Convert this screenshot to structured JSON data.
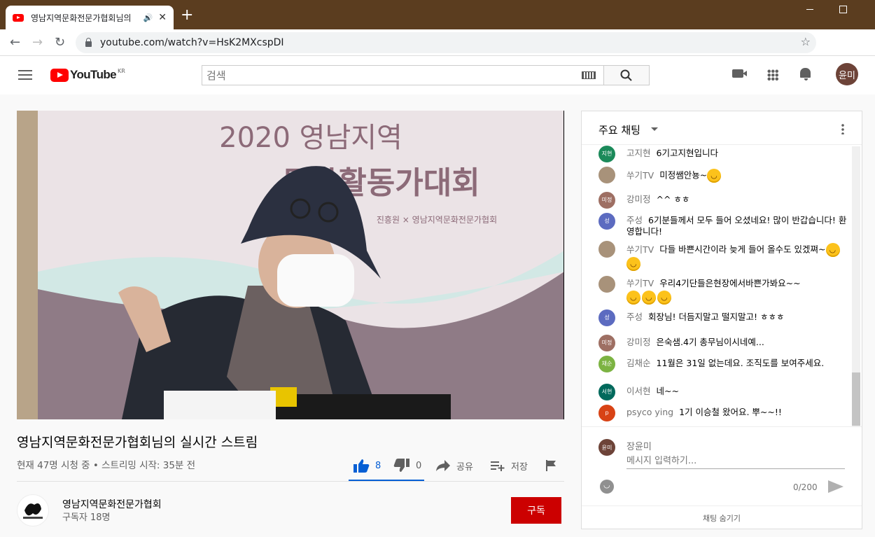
{
  "browser": {
    "tab_title": "영남지역문화전문가협회님의",
    "url": "youtube.com/watch?v=HsK2MXcspDI",
    "profile_initials": "윤미"
  },
  "header": {
    "logo_text": "YouTube",
    "region": "KR",
    "search_placeholder": "검색",
    "avatar_initials": "윤미"
  },
  "video": {
    "overlay_line1": "2020 영남지역",
    "overlay_line2": "문화활동가대회",
    "overlay_small": "진흥원 × 영남지역문화전문가협회",
    "title": "영남지역문화전문가협회님의 실시간 스트림",
    "info": "현재 47명 시청 중 • 스트리밍 시작: 35분 전",
    "likes": "8",
    "dislikes": "0",
    "share_label": "공유",
    "save_label": "저장"
  },
  "channel": {
    "name": "영남지역문화전문가협회",
    "subscribers": "구독자 18명",
    "subscribe_label": "구독"
  },
  "chat": {
    "title": "주요 채팅",
    "messages": [
      {
        "avatar": "지현",
        "color": "#1b8a5a",
        "author": "고지현",
        "text": "6기고지현입니다",
        "emojis": 0
      },
      {
        "avatar": "",
        "color": "#a8927a",
        "author": "쑤기TV",
        "text": "미정쌤안뇽~",
        "emojis": 1
      },
      {
        "avatar": "미정",
        "color": "#9e6f63",
        "author": "강미정",
        "text": "^^ ㅎㅎ",
        "emojis": 0
      },
      {
        "avatar": "성",
        "color": "#5c6bc0",
        "author": "주성",
        "text": "6기분들께서 모두 들어 오셨네요! 많이 반갑습니다! 환영합니다!",
        "emojis": 0
      },
      {
        "avatar": "",
        "color": "#a8927a",
        "author": "쑤기TV",
        "text": "다들 바쁜시간이라 늦게 들어 올수도 있겠쪄~",
        "emojis": 2
      },
      {
        "avatar": "",
        "color": "#a8927a",
        "author": "쑤기TV",
        "text": "우리4기단들은현장에서바쁜가봐요~~",
        "emojis": 3
      },
      {
        "avatar": "성",
        "color": "#5c6bc0",
        "author": "주성",
        "text": "회장님! 더듬지말고 떨지말고! ㅎㅎㅎ",
        "emojis": 0
      },
      {
        "avatar": "미정",
        "color": "#9e6f63",
        "author": "강미정",
        "text": "은숙샘.4기 총무님이시네예...",
        "emojis": 0
      },
      {
        "avatar": "채순",
        "color": "#7cb342",
        "author": "김채순",
        "text": "11월은 31일 없는데요. 조직도를 보여주세요.",
        "emojis": 0
      },
      {
        "avatar": "서현",
        "color": "#00695c",
        "author": "이서현",
        "text": "네~~",
        "emojis": 0
      },
      {
        "avatar": "p",
        "color": "#d84315",
        "author": "psyco ying",
        "text": "1기 이승철 왔어요. 뿌~~!!",
        "emojis": 0
      }
    ],
    "my_name": "장윤미",
    "my_avatar": "윤미",
    "input_placeholder": "메시지 입력하기...",
    "char_count": "0/200",
    "hide_label": "채팅 숨기기"
  }
}
